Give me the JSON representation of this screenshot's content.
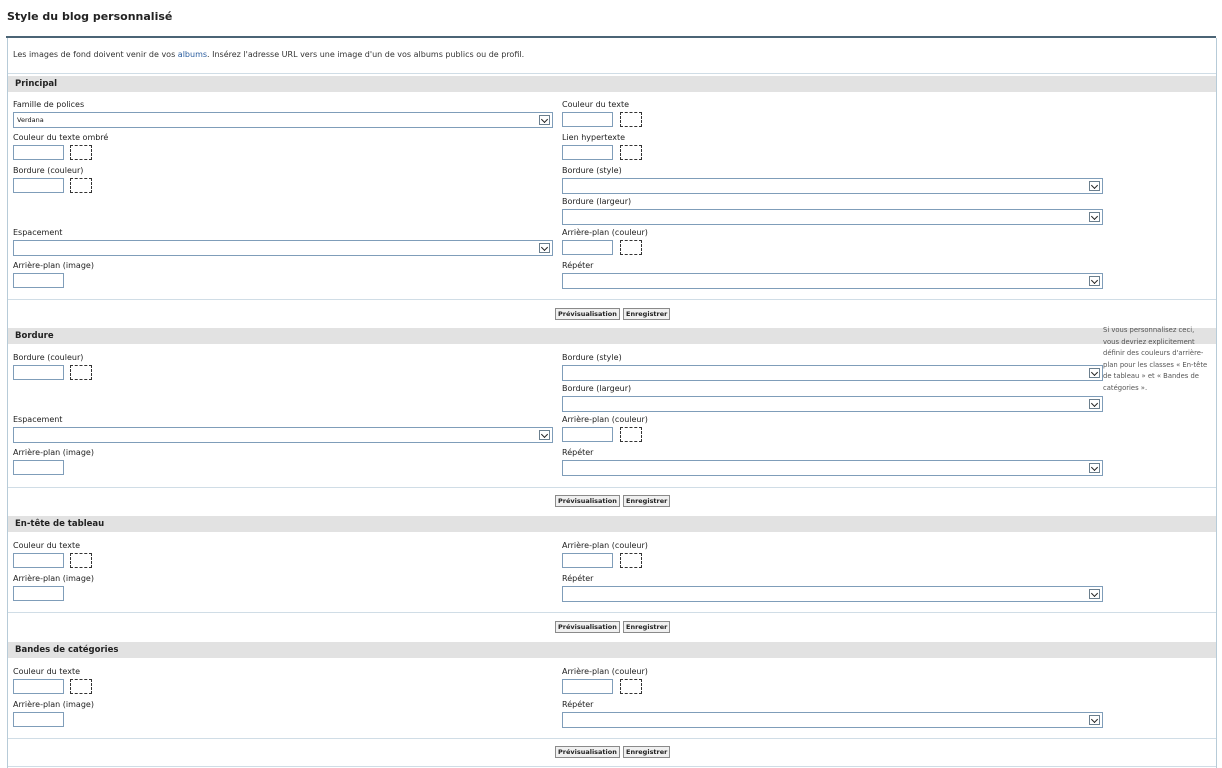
{
  "page": {
    "title": "Style du blog personnalisé"
  },
  "intro": {
    "before": "Les images de fond doivent venir de vos ",
    "link": "albums",
    "after": ". Insérez l'adresse URL vers une image d'un de vos albums publics ou de profil."
  },
  "sections": {
    "principal": {
      "title": "Principal",
      "font_family_label": "Famille de polices",
      "font_family_value": "Verdana",
      "text_color_label": "Couleur du texte",
      "shadow_color_label": "Couleur du texte ombré",
      "link_label": "Lien hypertexte",
      "border_color_label": "Bordure (couleur)",
      "border_style_label": "Bordure (style)",
      "border_width_label": "Bordure (largeur)",
      "spacing_label": "Espacement",
      "bg_color_label": "Arrière-plan (couleur)",
      "bg_image_label": "Arrière-plan (image)",
      "repeat_label": "Répéter"
    },
    "bordure": {
      "title": "Bordure",
      "border_color_label": "Bordure (couleur)",
      "border_style_label": "Bordure (style)",
      "border_width_label": "Bordure (largeur)",
      "spacing_label": "Espacement",
      "bg_color_label": "Arrière-plan (couleur)",
      "bg_image_label": "Arrière-plan (image)",
      "repeat_label": "Répéter",
      "note": "Si vous personnalisez ceci, vous devriez explicitement définir des couleurs d'arrière-plan pour les classes « En-tête de tableau » et « Bandes de catégories »."
    },
    "entete": {
      "title": "En-tête de tableau",
      "text_color_label": "Couleur du texte",
      "bg_color_label": "Arrière-plan (couleur)",
      "bg_image_label": "Arrière-plan (image)",
      "repeat_label": "Répéter"
    },
    "bandes": {
      "title": "Bandes de catégories",
      "text_color_label": "Couleur du texte",
      "bg_color_label": "Arrière-plan (couleur)",
      "bg_image_label": "Arrière-plan (image)",
      "repeat_label": "Répéter"
    }
  },
  "buttons": {
    "preview": "Prévisualisation",
    "save": "Enregistrer"
  },
  "colors": {
    "header_rule": "#4b6475",
    "section_bg": "#e2e2e2",
    "link": "#2a5d9f"
  }
}
